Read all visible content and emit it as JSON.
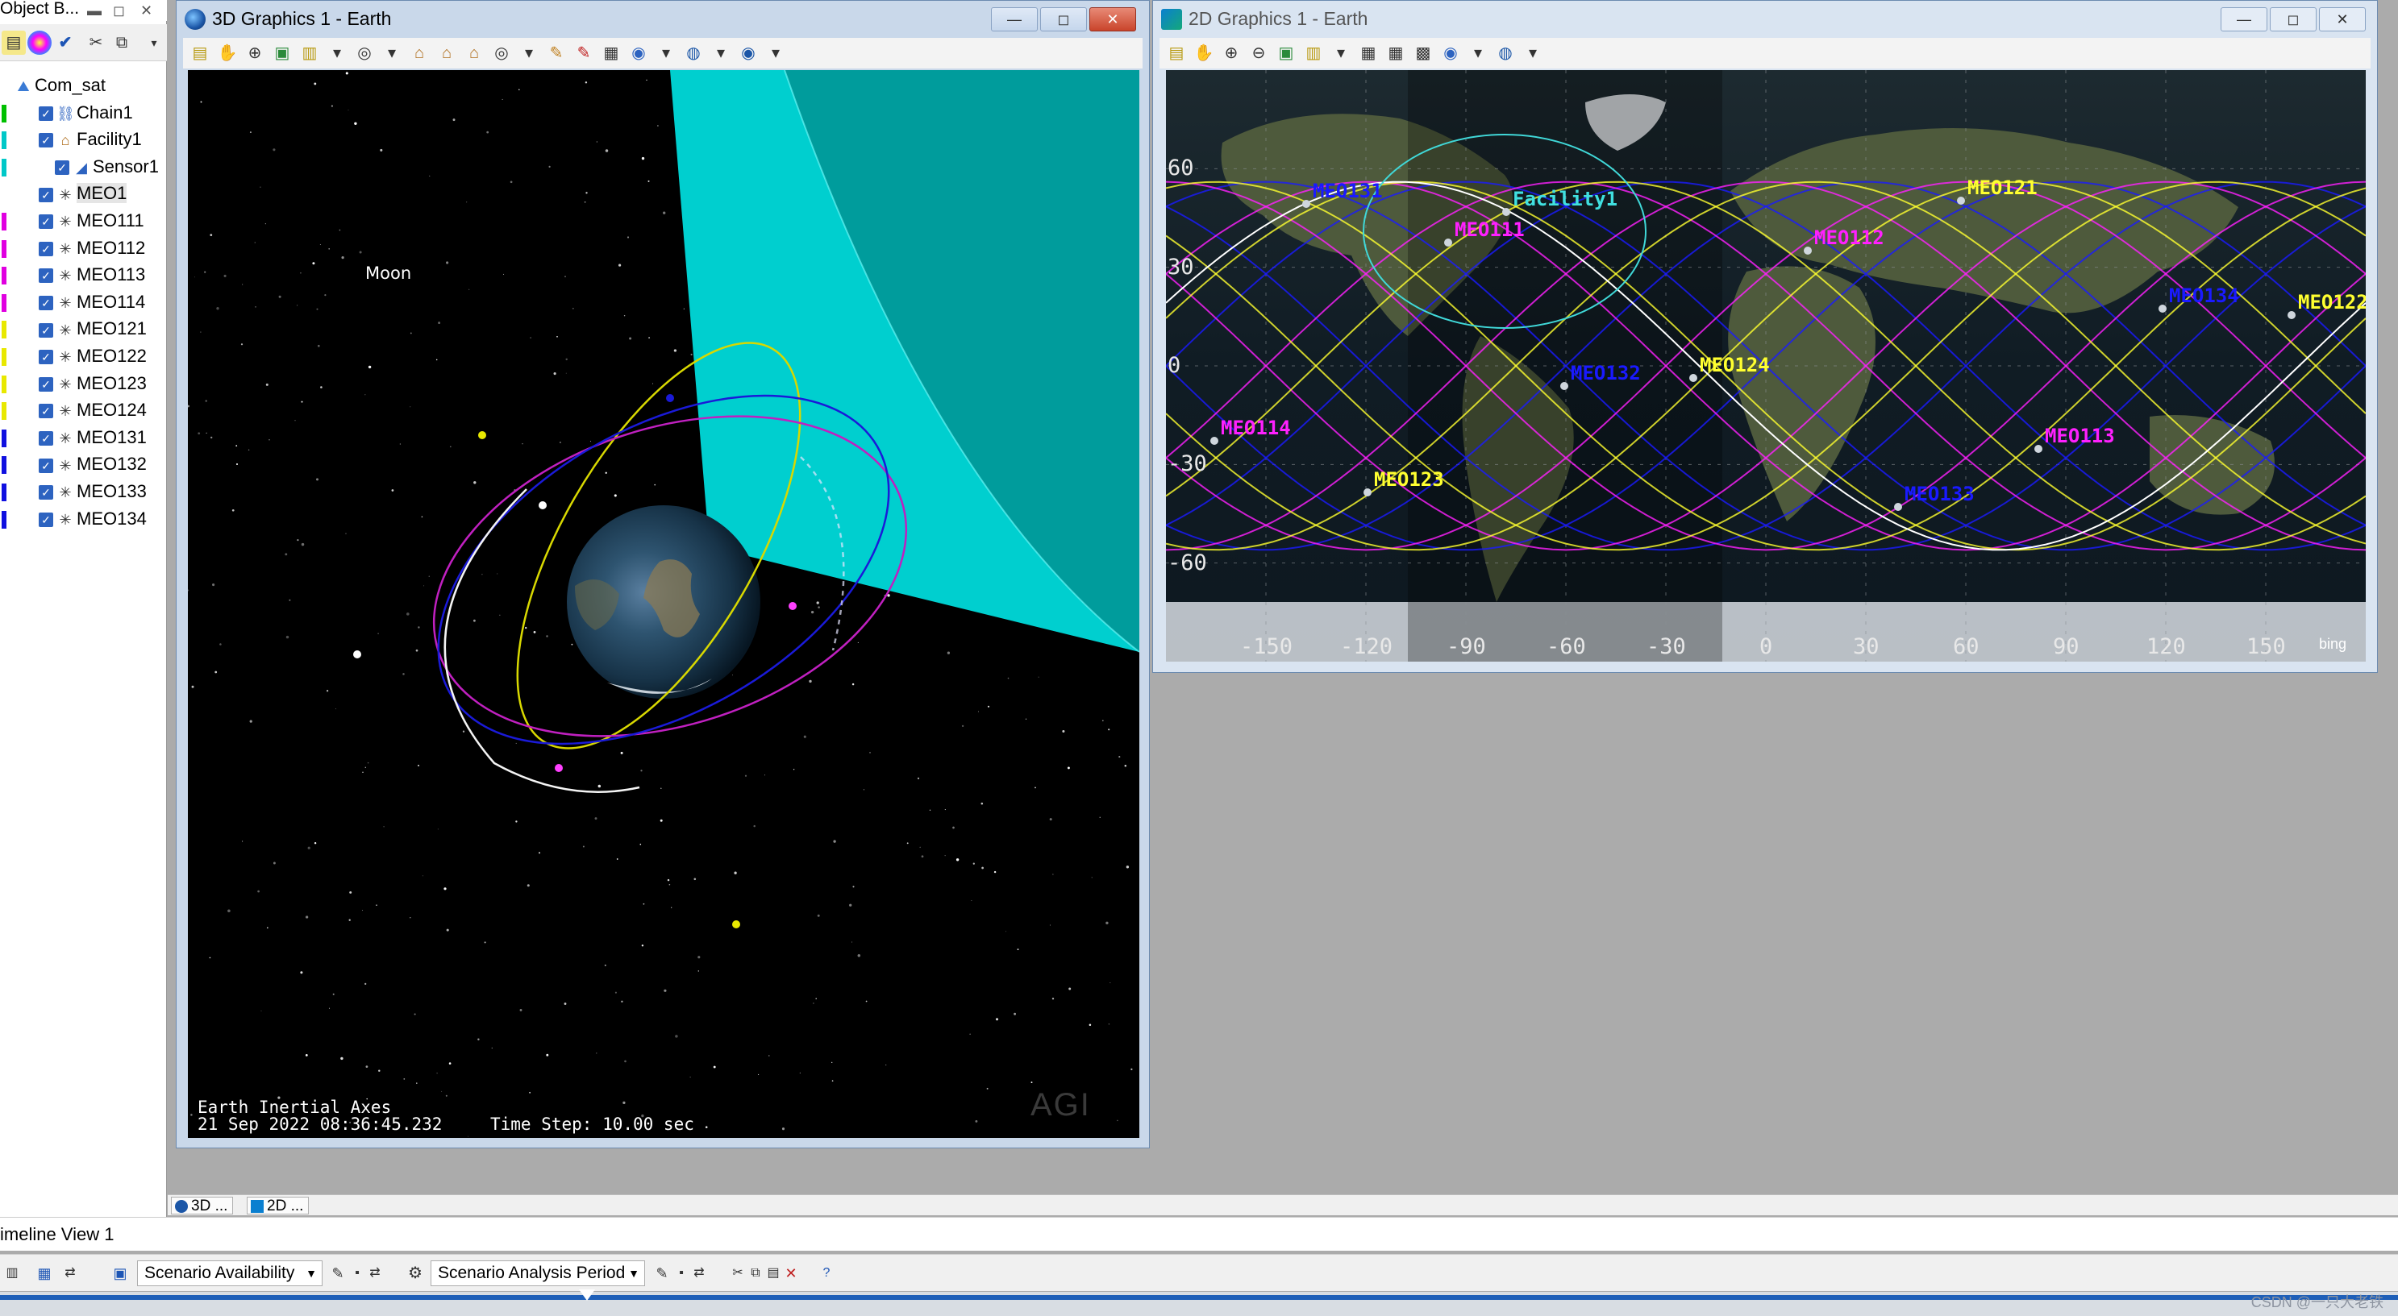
{
  "object_browser": {
    "title": "Object B...",
    "tree": [
      {
        "label": "Com_sat",
        "icon": "scenario-icon",
        "level": 0,
        "stripe": ""
      },
      {
        "label": "Chain1",
        "icon": "chain-icon",
        "level": 1,
        "stripe": "#00c000"
      },
      {
        "label": "Facility1",
        "icon": "facility-icon",
        "level": 1,
        "stripe": "#00c8c8"
      },
      {
        "label": "Sensor1",
        "icon": "sensor-icon",
        "level": 2,
        "stripe": "#00c8c8"
      },
      {
        "label": "MEO1",
        "icon": "satellite-icon",
        "level": 1,
        "stripe": "#ffffff",
        "selected": true
      },
      {
        "label": "MEO111",
        "icon": "satellite-icon",
        "level": 1,
        "stripe": "#e000e0"
      },
      {
        "label": "MEO112",
        "icon": "satellite-icon",
        "level": 1,
        "stripe": "#e000e0"
      },
      {
        "label": "MEO113",
        "icon": "satellite-icon",
        "level": 1,
        "stripe": "#e000e0"
      },
      {
        "label": "MEO114",
        "icon": "satellite-icon",
        "level": 1,
        "stripe": "#e000e0"
      },
      {
        "label": "MEO121",
        "icon": "satellite-icon",
        "level": 1,
        "stripe": "#e8e800"
      },
      {
        "label": "MEO122",
        "icon": "satellite-icon",
        "level": 1,
        "stripe": "#e8e800"
      },
      {
        "label": "MEO123",
        "icon": "satellite-icon",
        "level": 1,
        "stripe": "#e8e800"
      },
      {
        "label": "MEO124",
        "icon": "satellite-icon",
        "level": 1,
        "stripe": "#e8e800"
      },
      {
        "label": "MEO131",
        "icon": "satellite-icon",
        "level": 1,
        "stripe": "#1010e0"
      },
      {
        "label": "MEO132",
        "icon": "satellite-icon",
        "level": 1,
        "stripe": "#1010e0"
      },
      {
        "label": "MEO133",
        "icon": "satellite-icon",
        "level": 1,
        "stripe": "#1010e0"
      },
      {
        "label": "MEO134",
        "icon": "satellite-icon",
        "level": 1,
        "stripe": "#1010e0"
      }
    ]
  },
  "window3d": {
    "title": "3D Graphics 1 - Earth",
    "moon_label": "Moon",
    "axes_label": "Earth Inertial Axes",
    "datetime": "21 Sep 2022 08:36:45.232",
    "time_step": "Time Step: 10.00 sec",
    "logo": "AGI"
  },
  "window2d": {
    "title": "2D Graphics 1 - Earth",
    "lat_labels": [
      "60",
      "30",
      "0",
      "-30",
      "-60"
    ],
    "lon_labels": [
      "-150",
      "-120",
      "-90",
      "-60",
      "-30",
      "0",
      "30",
      "60",
      "90",
      "120",
      "150"
    ],
    "facility_label": "Facility1",
    "bing": "bing",
    "sat_labels": [
      {
        "text": "MEO131",
        "color": "#1a1aff"
      },
      {
        "text": "MEO111",
        "color": "#ff20ff"
      },
      {
        "text": "Facility1",
        "color": "#40e0e0"
      },
      {
        "text": "MEO121",
        "color": "#ffff30"
      },
      {
        "text": "MEO112",
        "color": "#ff20ff"
      },
      {
        "text": "MEO134",
        "color": "#1a1aff"
      },
      {
        "text": "MEO122",
        "color": "#ffff30"
      },
      {
        "text": "MEO132",
        "color": "#1a1aff"
      },
      {
        "text": "MEO124",
        "color": "#ffff30"
      },
      {
        "text": "MEO114",
        "color": "#ff20ff"
      },
      {
        "text": "MEO113",
        "color": "#ff20ff"
      },
      {
        "text": "MEO123",
        "color": "#ffff30"
      },
      {
        "text": "MEO133",
        "color": "#1a1aff"
      }
    ]
  },
  "tabs": [
    {
      "label": "3D ...",
      "icon": "globe-icon"
    },
    {
      "label": "2D ...",
      "icon": "map-icon"
    }
  ],
  "timeline": {
    "title": "imeline View 1",
    "availability": "Scenario Availability",
    "analysis_period": "Scenario Analysis Period"
  },
  "watermark": "CSDN @一只大老铁",
  "colors": {
    "magenta": "#ff20ff",
    "yellow": "#ffff30",
    "blue": "#1a1aff",
    "cyan": "#00c8c8"
  }
}
